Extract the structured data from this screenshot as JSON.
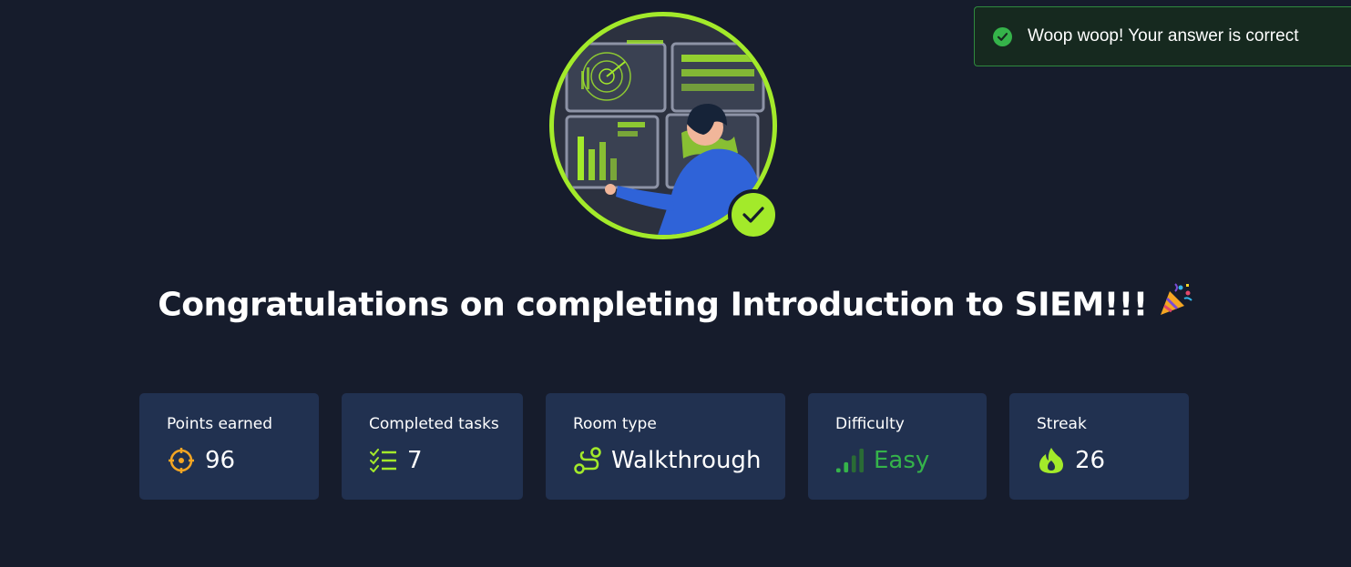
{
  "toast": {
    "message": "Woop woop! Your answer is correct",
    "icon": "check-circle-icon",
    "color": "#35b34a"
  },
  "hero": {
    "image": "analyst-monitoring-screens-illustration",
    "badge_icon": "checkmark-icon",
    "accent": "#a3ea2a"
  },
  "title": {
    "text": "Congratulations on completing Introduction to SIEM!!!",
    "emoji": "🎉"
  },
  "stats": [
    {
      "label": "Points earned",
      "value": "96",
      "icon": "target-icon",
      "icon_color": "#f5a623"
    },
    {
      "label": "Completed tasks",
      "value": "7",
      "icon": "checklist-icon",
      "icon_color": "#a3ea2a"
    },
    {
      "label": "Room type",
      "value": "Walkthrough",
      "icon": "route-icon",
      "icon_color": "#a3ea2a"
    },
    {
      "label": "Difficulty",
      "value": "Easy",
      "icon": "signal-bars-icon",
      "icon_color": "#35b34a"
    },
    {
      "label": "Streak",
      "value": "26",
      "icon": "flame-icon",
      "icon_color": "#a3ea2a"
    }
  ],
  "colors": {
    "background": "#161c2c",
    "card": "#213150",
    "accent": "#a3ea2a"
  }
}
